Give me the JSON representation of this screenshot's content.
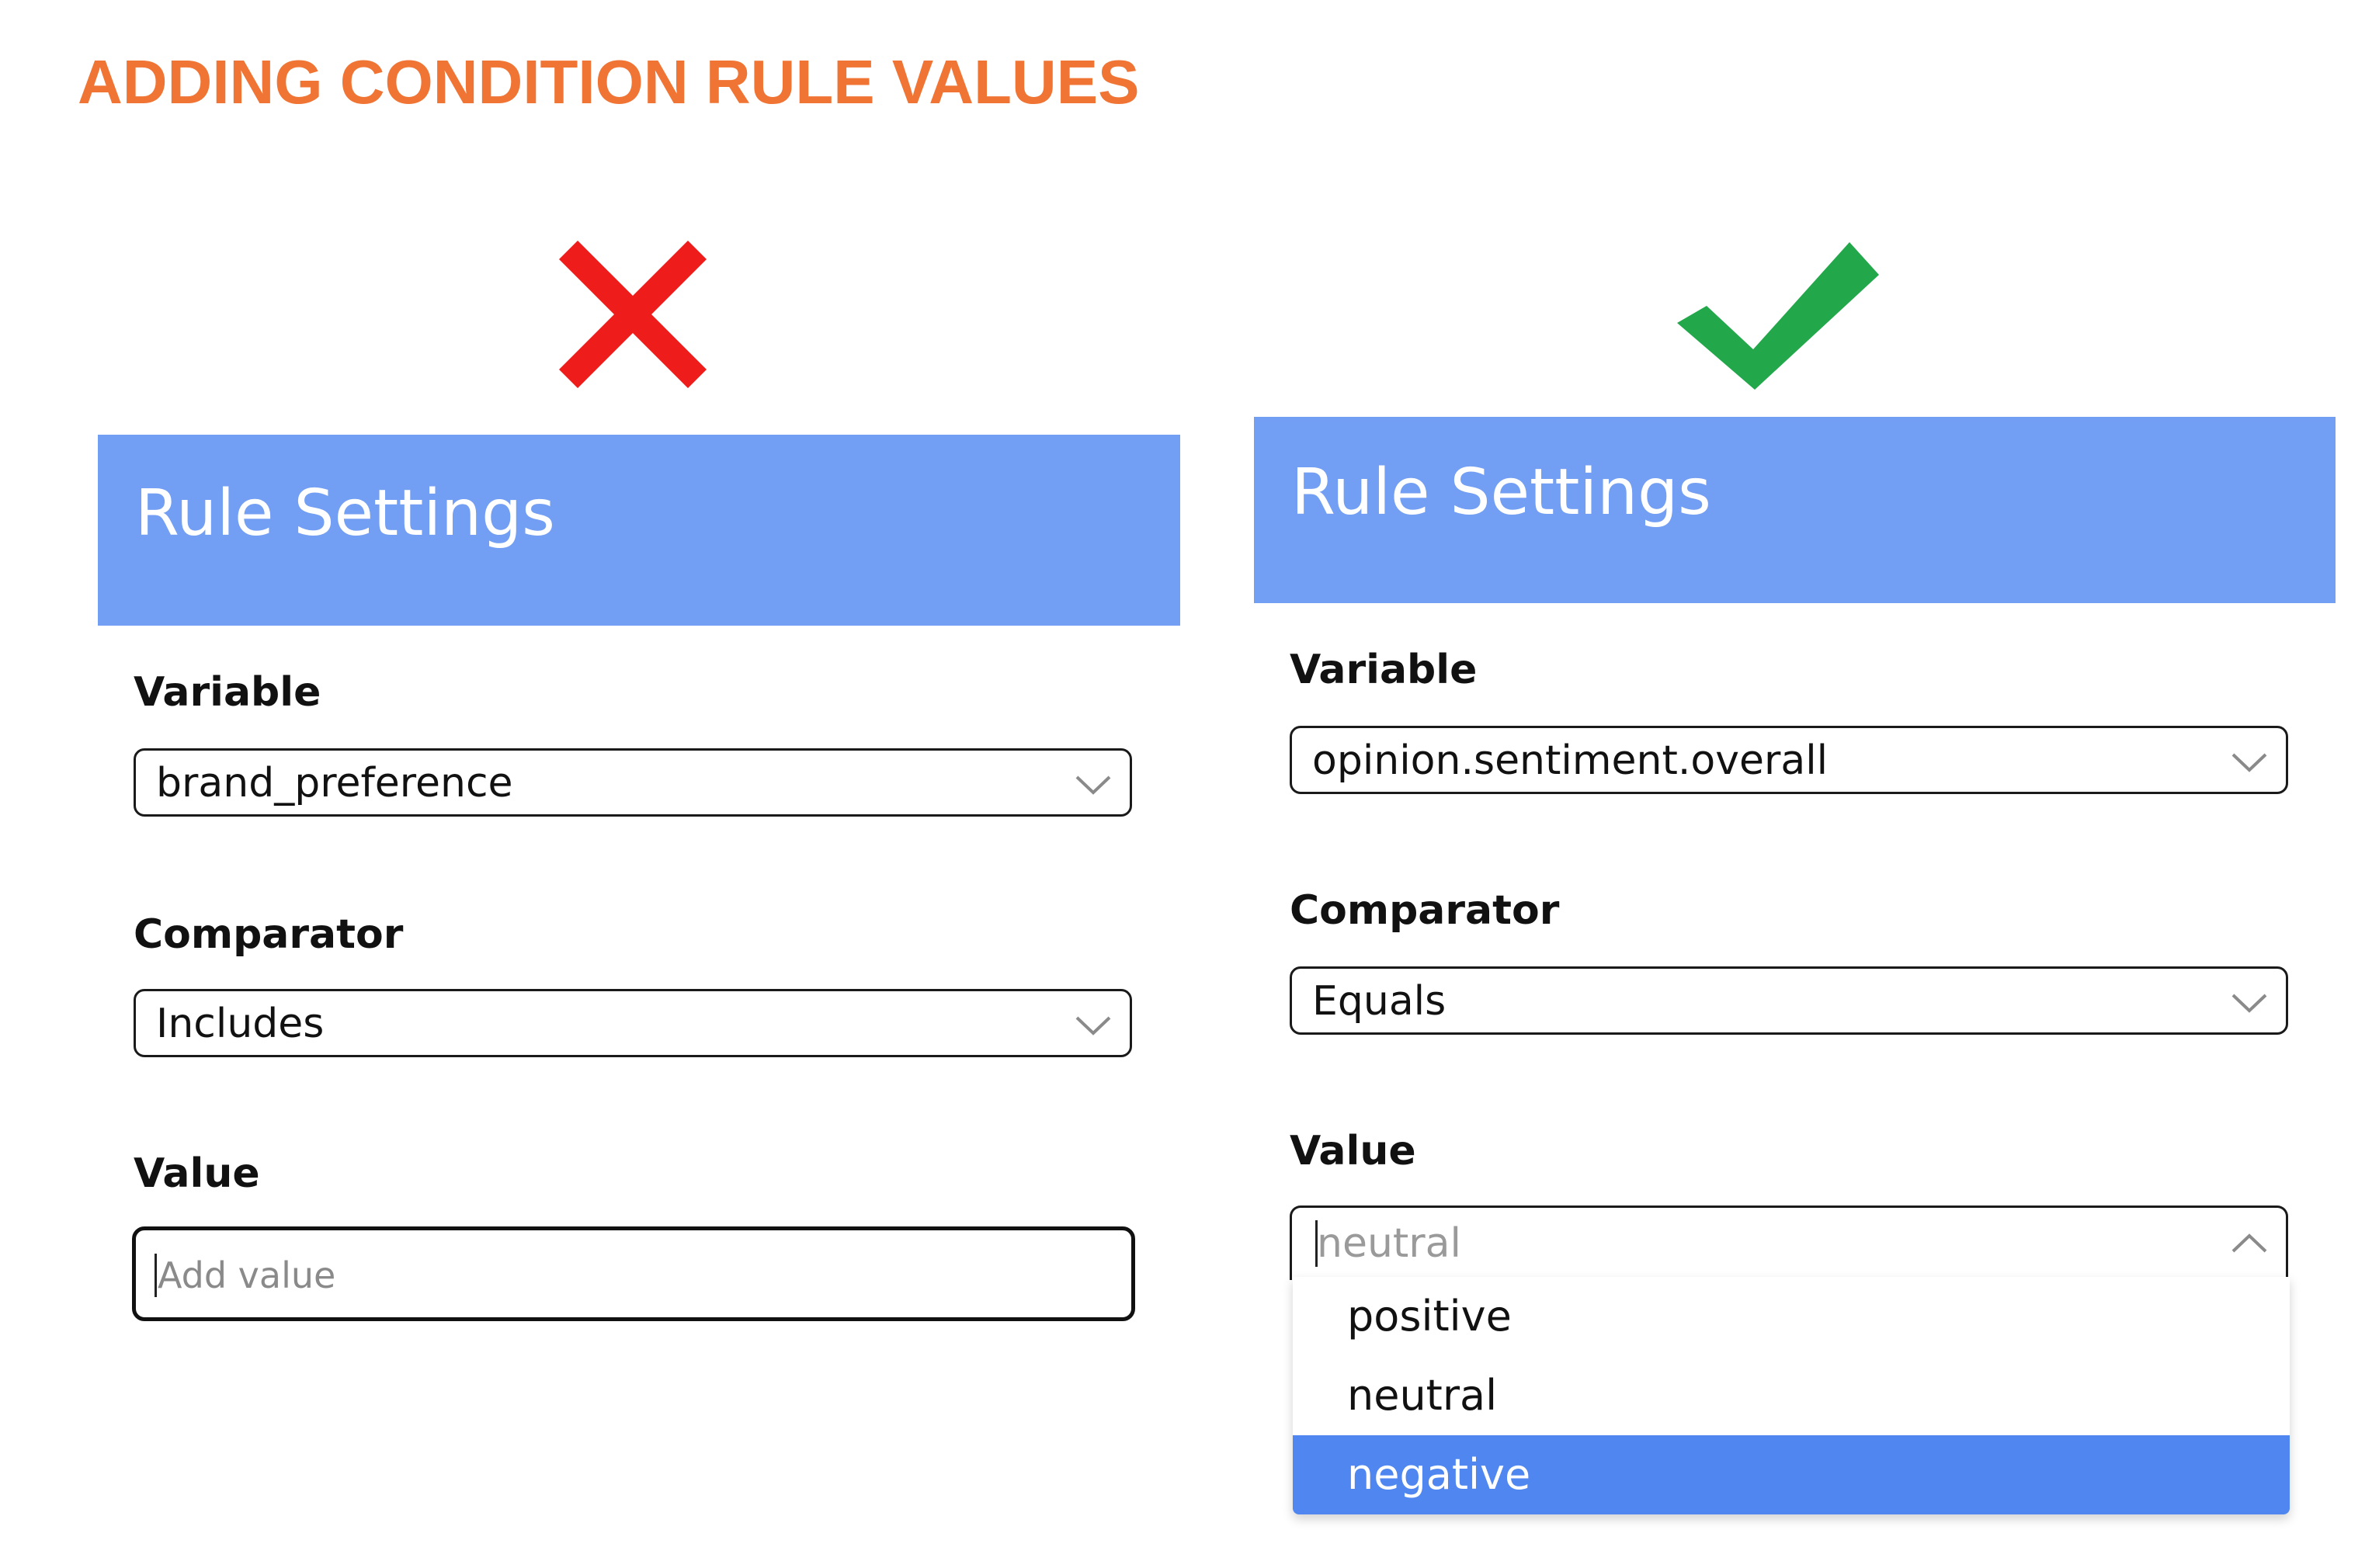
{
  "page": {
    "title": "ADDING CONDITION RULE VALUES",
    "title_color": "#f07434"
  },
  "marks": {
    "incorrect_icon": "cross-icon",
    "incorrect_color": "#ef1c1c",
    "correct_icon": "check-icon",
    "correct_color": "#22a84a"
  },
  "left_panel": {
    "header_color": "#729ef3",
    "title": "Rule Settings",
    "variable_label": "Variable",
    "variable_value": "brand_preference",
    "comparator_label": "Comparator",
    "comparator_value": "Includes",
    "value_label": "Value",
    "value_placeholder": "Add value"
  },
  "right_panel": {
    "header_color": "#729ef3",
    "title": "Rule Settings",
    "variable_label": "Variable",
    "variable_value": "opinion.sentiment.overall",
    "comparator_label": "Comparator",
    "comparator_value": "Equals",
    "value_label": "Value",
    "value_placeholder": "neutral",
    "dropdown_options": [
      "positive",
      "neutral",
      "negative"
    ],
    "selected_option": "negative",
    "highlight_color": "#4f86f0"
  }
}
